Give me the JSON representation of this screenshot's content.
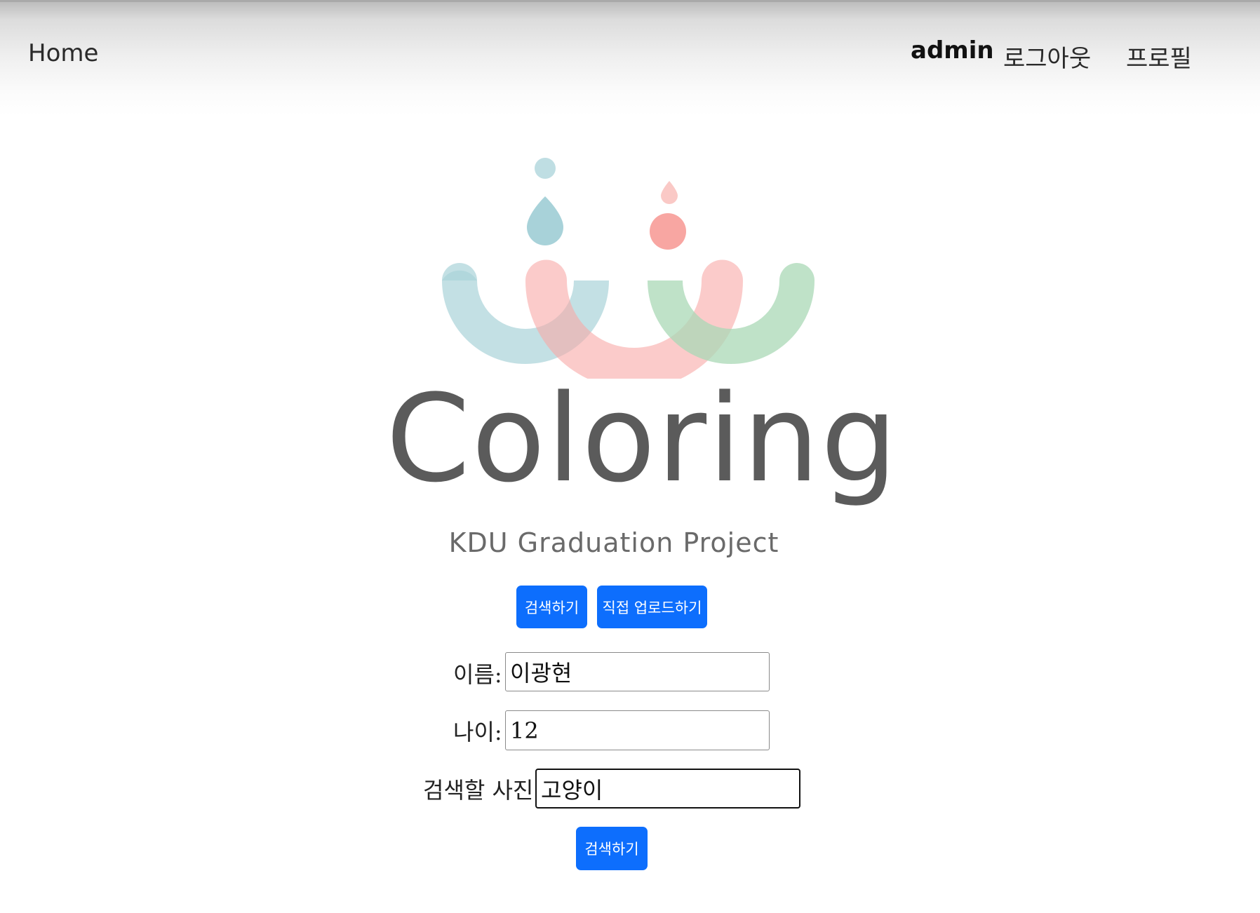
{
  "nav": {
    "home": "Home",
    "user": "admin",
    "logout": "로그아웃",
    "profile": "프로필"
  },
  "brand": {
    "title": "Coloring",
    "subtitle": "KDU Graduation Project",
    "colors": {
      "blue": "#a9d3d9",
      "pink": "#f9a9a6",
      "green": "#b7dfc4",
      "text": "#5b5b5b"
    }
  },
  "buttons": {
    "search_mode": "검색하기",
    "upload_mode": "직접 업로드하기",
    "submit": "검색하기",
    "color": "#0d6efd"
  },
  "form": {
    "name_label": "이름:",
    "name_value": "이광현",
    "age_label": "나이:",
    "age_value": "12",
    "photo_label": "검색할 사진:",
    "photo_value": "고양이"
  }
}
